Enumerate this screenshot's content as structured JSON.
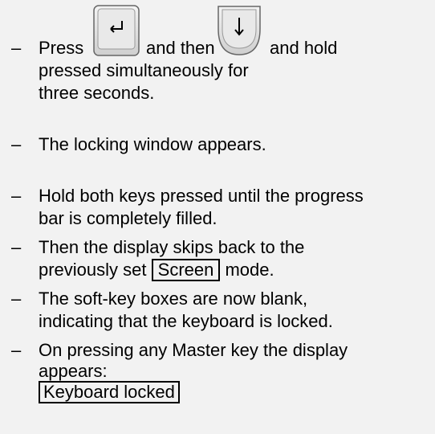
{
  "steps": [
    {
      "parts": {
        "a": "Press",
        "b": "and then",
        "c": "and hold",
        "line2": "pressed simultaneously for",
        "line3": "three seconds."
      },
      "icons": [
        "enter-key-icon",
        "down-arrow-key-icon"
      ]
    },
    {
      "line1": "The locking window appears."
    },
    {
      "line1": "Hold both keys pressed until the progress",
      "line2": "bar is completely filled."
    },
    {
      "line1": "Then the display skips back to the",
      "line2_pre": "previously set",
      "line2_boxed": "Screen",
      "line2_post": "mode."
    },
    {
      "line1": "The soft-key boxes are now blank,",
      "line2": "indicating that the keyboard is locked."
    },
    {
      "line1": "On pressing any Master key the display",
      "line2": "appears:",
      "boxed": "Keyboard locked"
    }
  ],
  "bullet": "–",
  "colors": {
    "background": "#f2f2f2",
    "key_fill": "#e6e6e6",
    "key_border": "#555555"
  }
}
